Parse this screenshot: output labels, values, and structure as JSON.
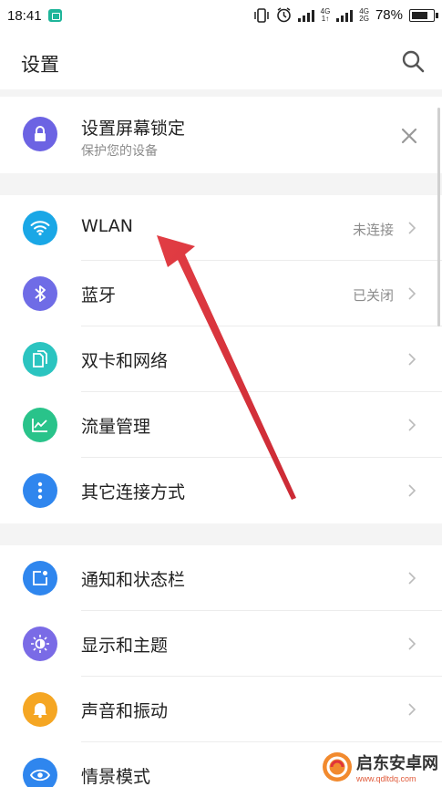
{
  "status_bar": {
    "time": "18:41",
    "net_top": "4G",
    "net_bottom": "1↑",
    "net2_top": "4G",
    "net2_bottom": "2G",
    "battery": "78%"
  },
  "header": {
    "title": "设置",
    "search_icon": "search-icon"
  },
  "lock_card": {
    "title": "设置屏幕锁定",
    "subtitle": "保护您的设备",
    "icon_color": "#6c5ce7"
  },
  "connection_items": [
    {
      "label": "WLAN",
      "value": "未连接",
      "icon": "wifi-icon",
      "color": "#1aa7e6"
    },
    {
      "label": "蓝牙",
      "value": "已关闭",
      "icon": "bluetooth-icon",
      "color": "#6f6ce6"
    },
    {
      "label": "双卡和网络",
      "value": "",
      "icon": "sim-icon",
      "color": "#2bc4c0"
    },
    {
      "label": "流量管理",
      "value": "",
      "icon": "traffic-chart-icon",
      "color": "#29c38a"
    },
    {
      "label": "其它连接方式",
      "value": "",
      "icon": "more-icon",
      "color": "#2f86ee"
    }
  ],
  "system_items": [
    {
      "label": "通知和状态栏",
      "icon": "notification-icon",
      "color": "#2f86ee"
    },
    {
      "label": "显示和主题",
      "icon": "brightness-icon",
      "color": "#7a6be6"
    },
    {
      "label": "声音和振动",
      "icon": "bell-icon",
      "color": "#f5a623"
    },
    {
      "label": "情景模式",
      "icon": "eye-icon",
      "color": "#2f86ee"
    }
  ],
  "watermark": {
    "name": "启东安卓网",
    "url": "www.qdltdq.com"
  },
  "colors": {
    "annotation_arrow": "#e0333a"
  }
}
